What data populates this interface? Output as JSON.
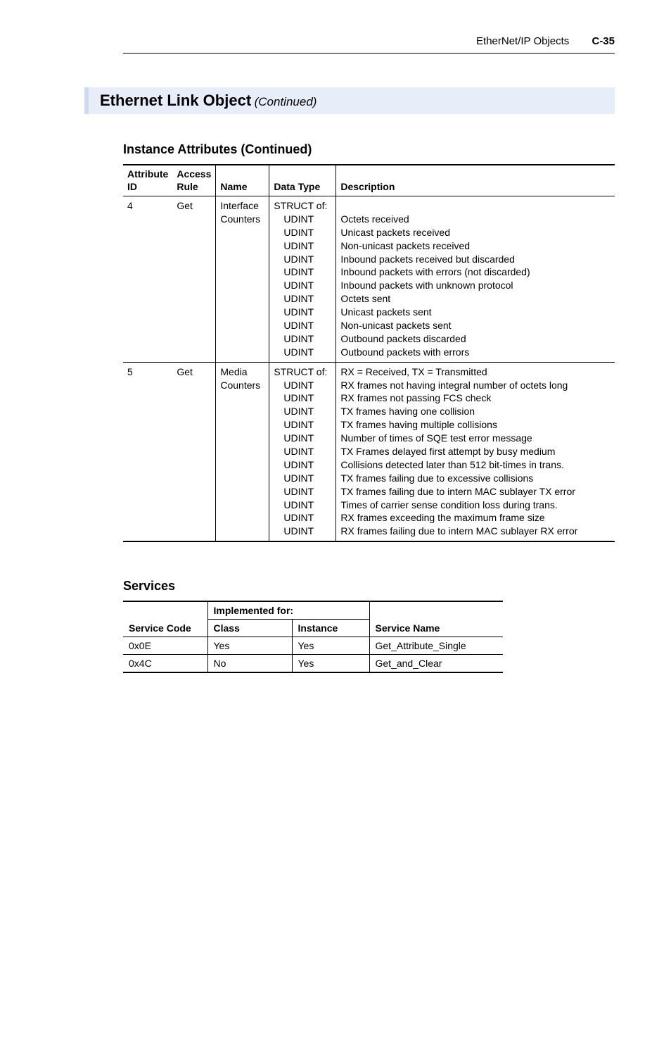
{
  "header": {
    "doc_title": "EtherNet/IP Objects",
    "page_no": "C-35"
  },
  "section": {
    "title": "Ethernet Link Object",
    "continued": "(Continued)"
  },
  "attributes": {
    "heading": "Instance Attributes (Continued)",
    "columns": {
      "attr_id": "Attribute ID",
      "access": "Access Rule",
      "name": "Name",
      "dtype": "Data Type",
      "desc": "Description"
    },
    "rows": [
      {
        "id": "4",
        "access": "Get",
        "name_lines": [
          "Interface",
          "Counters"
        ],
        "dtype_lines": [
          "STRUCT of:",
          "UDINT",
          "UDINT",
          "UDINT",
          "UDINT",
          "UDINT",
          "UDINT",
          "UDINT",
          "UDINT",
          "UDINT",
          "UDINT",
          "UDINT"
        ],
        "desc_lines": [
          "",
          "Octets received",
          "Unicast packets received",
          "Non-unicast packets received",
          "Inbound packets received but discarded",
          "Inbound packets with errors (not discarded)",
          "Inbound packets with unknown protocol",
          "Octets sent",
          "Unicast packets sent",
          "Non-unicast packets sent",
          "Outbound packets discarded",
          "Outbound packets with errors"
        ]
      },
      {
        "id": "5",
        "access": "Get",
        "name_lines": [
          "Media",
          "Counters"
        ],
        "dtype_lines": [
          "STRUCT of:",
          "UDINT",
          "UDINT",
          "UDINT",
          "UDINT",
          "UDINT",
          "UDINT",
          "UDINT",
          "UDINT",
          "UDINT",
          "UDINT",
          "UDINT",
          "UDINT"
        ],
        "desc_lines": [
          "RX = Received, TX = Transmitted",
          "RX frames not having integral number of octets long",
          "RX frames not passing FCS check",
          "TX frames having one collision",
          "TX frames having multiple collisions",
          "Number of times of SQE test error message",
          "TX Frames delayed first attempt by busy medium",
          "Collisions detected later than 512 bit-times in trans.",
          "TX frames failing due to excessive collisions",
          "TX frames failing due to intern MAC sublayer TX error",
          "Times of carrier sense condition loss during trans.",
          "RX frames exceeding the maximum frame size",
          "RX frames failing due to intern MAC sublayer RX error"
        ]
      }
    ]
  },
  "services": {
    "heading": "Services",
    "group_label": "Implemented for:",
    "columns": {
      "code": "Service Code",
      "cls": "Class",
      "inst": "Instance",
      "name": "Service Name"
    },
    "rows": [
      {
        "code": "0x0E",
        "cls": "Yes",
        "inst": "Yes",
        "name": "Get_Attribute_Single"
      },
      {
        "code": "0x4C",
        "cls": "No",
        "inst": "Yes",
        "name": "Get_and_Clear"
      }
    ]
  }
}
